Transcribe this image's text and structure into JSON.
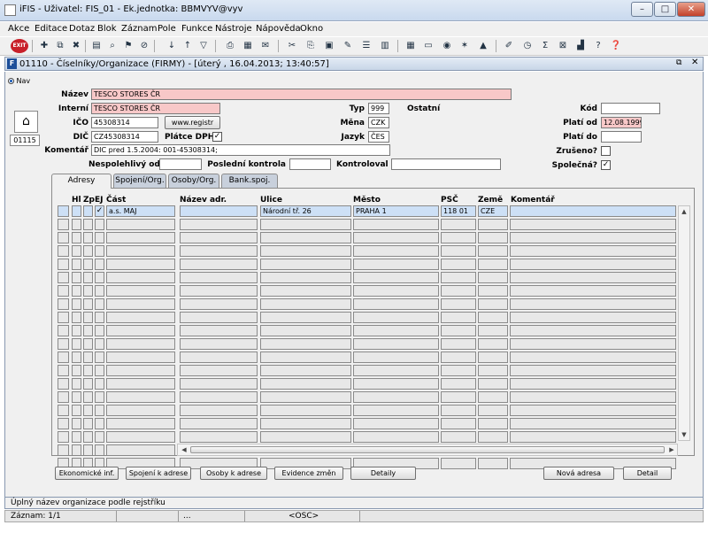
{
  "window": {
    "title": "iFIS - Uživatel: FIS_01 - Ek.jednotka: BBMVYV@vyv",
    "controls": {
      "minimize": "–",
      "maximize": "□",
      "close": "✕"
    }
  },
  "menu": [
    "Akce",
    "Editace",
    "Dotaz",
    "Blok",
    "Záznam",
    "Pole",
    "Funkce",
    "Nástroje",
    "Nápověda",
    "Okno"
  ],
  "toolbar": {
    "exit_label": "EXIT"
  },
  "form": {
    "title": "01110 - Číselníky/Organizace (FIRMY) - [úterý , 16.04.2013; 13:40:57]",
    "nav_label": "Nav",
    "code_box": "01115"
  },
  "fields": {
    "nazev": {
      "label": "Název",
      "value": "TESCO STORES ČR"
    },
    "interni": {
      "label": "Interní",
      "value": "TESCO STORES ČR"
    },
    "ico": {
      "label": "IČO",
      "value": "45308314"
    },
    "dic": {
      "label": "DIČ",
      "value": "CZ45308314"
    },
    "komentar": {
      "label": "Komentář",
      "value": "DIC pred 1.5.2004: 001-45308314;"
    },
    "www_button": "www.registr",
    "platce_dph": {
      "label": "Plátce DPH",
      "checked": true
    },
    "typ": {
      "label": "Typ",
      "value": "999",
      "desc": "Ostatní"
    },
    "mena": {
      "label": "Měna",
      "value": "CZK"
    },
    "jazyk": {
      "label": "Jazyk",
      "value": "ČES"
    },
    "kod": {
      "label": "Kód",
      "value": ""
    },
    "plati_od": {
      "label": "Platí od",
      "value": "12.08.1999"
    },
    "plati_do": {
      "label": "Platí do",
      "value": ""
    },
    "zruseno": {
      "label": "Zrušeno?",
      "checked": false
    },
    "spolecna": {
      "label": "Společná?",
      "checked": true
    },
    "nespolehlivy_od": {
      "label": "Nespolehlivý od",
      "value": ""
    },
    "posledni_kontrola": {
      "label": "Poslední kontrola",
      "value": ""
    },
    "kontroloval": {
      "label": "Kontroloval",
      "value": ""
    }
  },
  "tabs": [
    "Adresy",
    "Spojení/Org.",
    "Osoby/Org.",
    "Bank.spoj."
  ],
  "address_table": {
    "columns": [
      "Hl",
      "Zp",
      "EJ",
      "Část",
      "Název adr.",
      "Ulice",
      "Město",
      "PSČ",
      "Země",
      "Komentář"
    ],
    "rows": [
      {
        "hl": "",
        "zp": "",
        "ej": "✓",
        "cast": "a.s. MAJ",
        "nazev": "",
        "ulice": "Národní tř. 26",
        "mesto": "PRAHA 1",
        "psc": "118 01",
        "zeme": "CZE",
        "komentar": ""
      }
    ],
    "visible_rows": 20
  },
  "buttons": {
    "ekonomicke": "Ekonomické inf.",
    "spojeni": "Spojení k adrese",
    "osoby": "Osoby k adrese",
    "evidence": "Evidence změn",
    "detaily": "Detaily",
    "nova_adresa": "Nová adresa",
    "detail": "Detail"
  },
  "status": {
    "hint": "Úplný název organizace podle rejstříku",
    "record": "Záznam: 1/1",
    "segment": "...",
    "mode": "<OSC>"
  }
}
